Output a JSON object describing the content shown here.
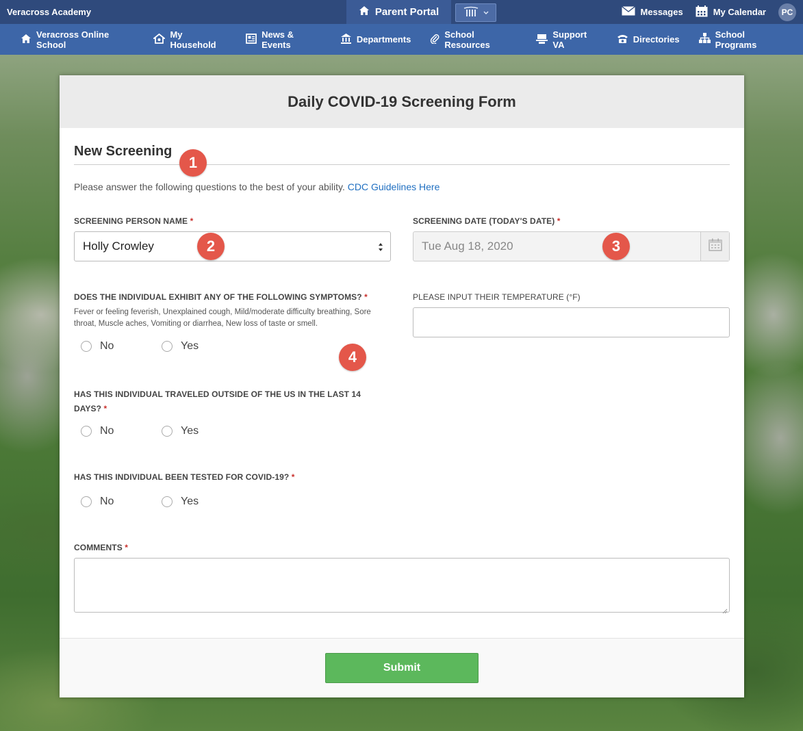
{
  "topbar": {
    "brand": "Veracross Academy",
    "portal_tab": "Parent Portal",
    "messages": "Messages",
    "calendar": "My Calendar",
    "avatar_initials": "PC"
  },
  "nav": {
    "items": [
      {
        "label": "Veracross Online School",
        "icon": "home-icon"
      },
      {
        "label": "My Household",
        "icon": "household-icon"
      },
      {
        "label": "News & Events",
        "icon": "news-icon"
      },
      {
        "label": "Departments",
        "icon": "departments-icon"
      },
      {
        "label": "School Resources",
        "icon": "paperclip-icon"
      },
      {
        "label": "Support VA",
        "icon": "support-icon"
      },
      {
        "label": "Directories",
        "icon": "phone-icon"
      },
      {
        "label": "School Programs",
        "icon": "programs-icon"
      }
    ]
  },
  "form": {
    "header_title": "Daily COVID-19 Screening Form",
    "section_title": "New Screening",
    "intro_text": "Please answer the following questions to the best of your ability.",
    "intro_link": "CDC Guidelines Here",
    "person_label": "SCREENING PERSON NAME",
    "person_value": "Holly Crowley",
    "date_label": "SCREENING DATE (TODAY'S DATE)",
    "date_value": "Tue Aug 18, 2020",
    "symptoms_label": "DOES THE INDIVIDUAL EXHIBIT ANY OF THE FOLLOWING SYMPTOMS?",
    "symptoms_hint": "Fever or feeling feverish, Unexplained cough, Mild/moderate difficulty breathing, Sore throat, Muscle aches, Vomiting or diarrhea, New loss of taste or smell.",
    "temperature_label": "PLEASE INPUT THEIR TEMPERATURE (°F)",
    "travel_label": "HAS THIS INDIVIDUAL TRAVELED OUTSIDE OF THE US IN THE LAST 14 DAYS?",
    "tested_label": "HAS THIS INDIVIDUAL BEEN TESTED FOR COVID-19?",
    "comments_label": "COMMENTS",
    "required_mark": "*",
    "option_no": "No",
    "option_yes": "Yes",
    "submit_label": "Submit"
  },
  "markers": [
    "1",
    "2",
    "3",
    "4"
  ],
  "colors": {
    "topbar": "#2f4a7c",
    "navbar": "#3d66a8",
    "submit": "#5cb85c",
    "marker": "#e4574a",
    "link": "#1f6fc1",
    "required": "#c9302c"
  }
}
